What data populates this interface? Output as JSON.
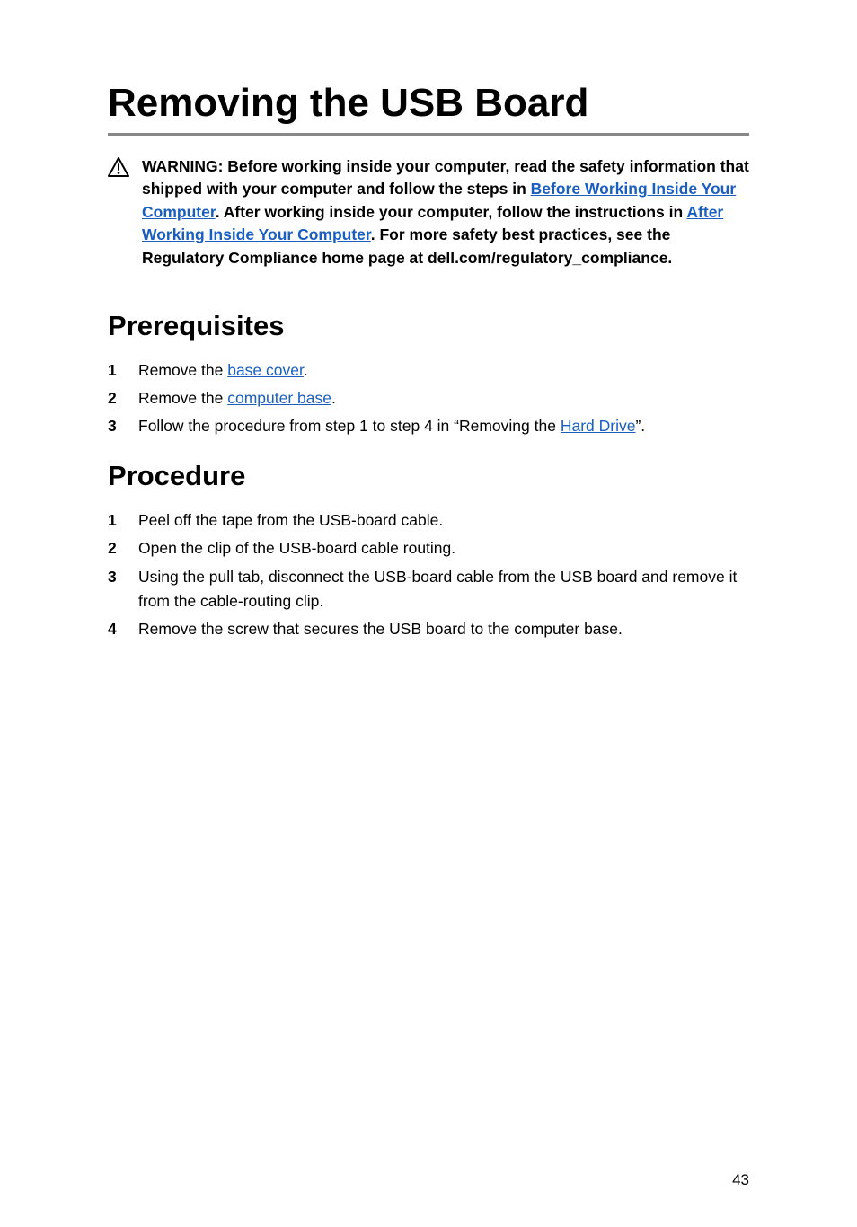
{
  "page": {
    "title": "Removing the USB Board",
    "number": "43"
  },
  "warning": {
    "prefix": "WARNING: Before working inside your computer, read the safety information that shipped with your computer and follow the steps in ",
    "link1": "Before Working Inside Your Computer",
    "middle1": ". After working inside your computer, follow the instructions in ",
    "link2": "After Working Inside Your Computer",
    "suffix": ". For more safety best practices, see the Regulatory Compliance home page at dell.com/regulatory_compliance."
  },
  "prerequisites": {
    "heading": "Prerequisites",
    "items": [
      {
        "num": "1",
        "pre": "Remove the ",
        "link": "base cover",
        "post": "."
      },
      {
        "num": "2",
        "pre": "Remove the ",
        "link": "computer base",
        "post": "."
      },
      {
        "num": "3",
        "pre": "Follow the procedure from step 1 to step 4 in “Removing the ",
        "link": "Hard Drive",
        "post": "”."
      }
    ]
  },
  "procedure": {
    "heading": "Procedure",
    "items": [
      {
        "num": "1",
        "text": "Peel off the tape from the USB-board cable."
      },
      {
        "num": "2",
        "text": "Open the clip of the USB-board cable routing."
      },
      {
        "num": "3",
        "text": "Using the pull tab, disconnect the USB-board cable from the USB board and remove it from the cable-routing clip."
      },
      {
        "num": "4",
        "text": "Remove the screw that secures the USB board to the computer base."
      }
    ]
  }
}
